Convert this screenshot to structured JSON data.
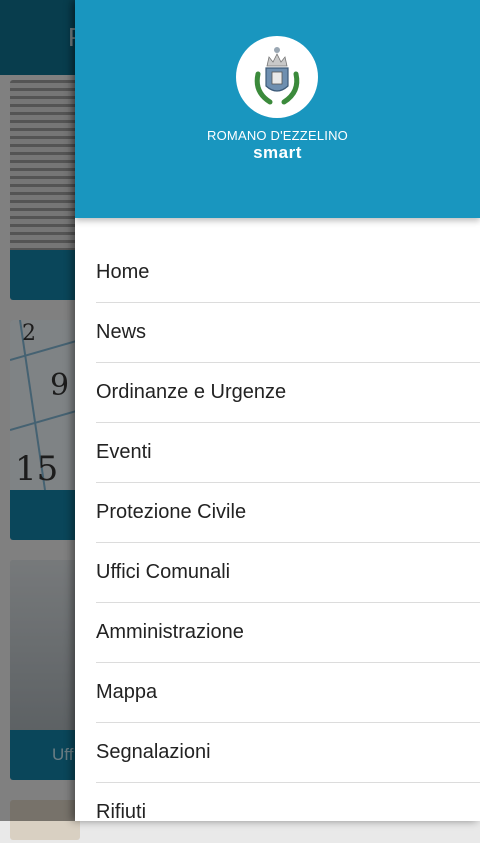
{
  "background": {
    "header_title": "P",
    "card3_label": "Uff"
  },
  "drawer": {
    "brand_line1": "ROMANO D'EZZELINO",
    "brand_line2": "smart",
    "menu": [
      {
        "label": "Home"
      },
      {
        "label": "News"
      },
      {
        "label": "Ordinanze e Urgenze"
      },
      {
        "label": "Eventi"
      },
      {
        "label": "Protezione Civile"
      },
      {
        "label": "Uffici Comunali"
      },
      {
        "label": "Amministrazione"
      },
      {
        "label": "Mappa"
      },
      {
        "label": "Segnalazioni"
      },
      {
        "label": "Rifiuti"
      }
    ]
  },
  "colors": {
    "drawer_header": "#1996bf",
    "app_header": "#0f6f8c",
    "card_bar": "#1380a4"
  }
}
